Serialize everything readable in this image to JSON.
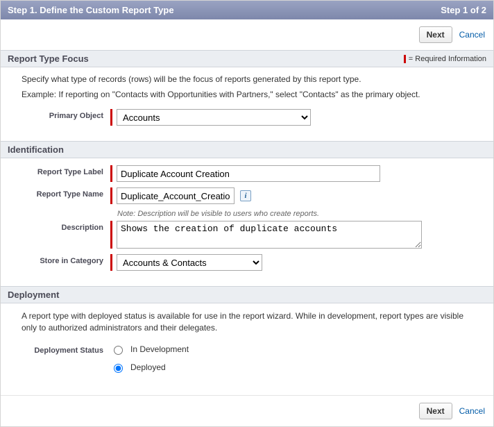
{
  "wizard": {
    "title": "Step 1. Define the Custom Report Type",
    "step_indicator": "Step 1 of 2"
  },
  "buttons": {
    "next_label": "Next",
    "cancel_label": "Cancel"
  },
  "section_focus": {
    "title": "Report Type Focus",
    "required_legend": "= Required Information",
    "instruction1": "Specify what type of records (rows) will be the focus of reports generated by this report type.",
    "instruction2": "Example: If reporting on \"Contacts with Opportunities with Partners,\" select \"Contacts\" as the primary object.",
    "primary_object_label": "Primary Object",
    "primary_object_value": "Accounts"
  },
  "section_ident": {
    "title": "Identification",
    "label_label": "Report Type Label",
    "label_value": "Duplicate Account Creation",
    "name_label": "Report Type Name",
    "name_value": "Duplicate_Account_Creation",
    "note": "Note: Description will be visible to users who create reports.",
    "desc_label": "Description",
    "desc_value": "Shows the creation of duplicate accounts",
    "category_label": "Store in Category",
    "category_value": "Accounts & Contacts"
  },
  "section_deploy": {
    "title": "Deployment",
    "description": "A report type with deployed status is available for use in the report wizard. While in development, report types are visible only to authorized administrators and their delegates.",
    "status_label": "Deployment Status",
    "option_dev": "In Development",
    "option_deployed": "Deployed",
    "selected": "deployed"
  }
}
